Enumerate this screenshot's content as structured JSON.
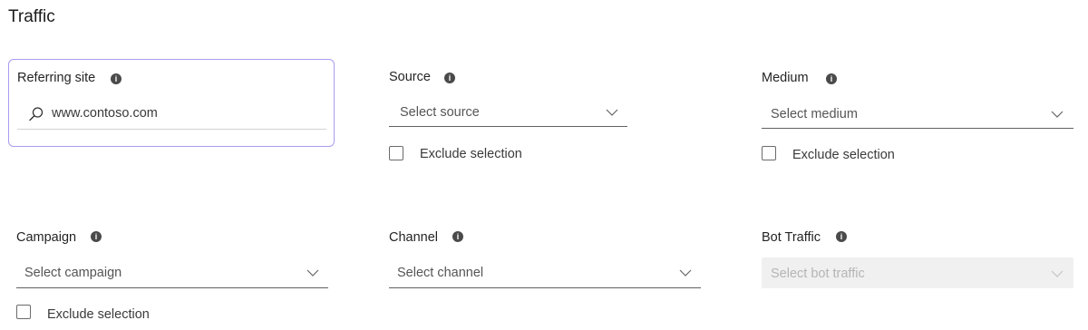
{
  "section": {
    "title": "Traffic"
  },
  "referring_site": {
    "label": "Referring site",
    "info_icon": "info-icon",
    "search_icon": "search-icon",
    "value": "www.contoso.com"
  },
  "source": {
    "label": "Source",
    "placeholder": "Select source",
    "exclude_label": "Exclude selection"
  },
  "medium": {
    "label": "Medium",
    "placeholder": "Select medium",
    "exclude_label": "Exclude selection"
  },
  "campaign": {
    "label": "Campaign",
    "placeholder": "Select campaign",
    "exclude_label": "Exclude selection"
  },
  "channel": {
    "label": "Channel",
    "placeholder": "Select channel"
  },
  "bot_traffic": {
    "label": "Bot Traffic",
    "placeholder": "Select bot traffic",
    "disabled": true
  },
  "colors": {
    "focus_border": "#a99cf0",
    "disabled_bg": "#f0f0f0"
  }
}
